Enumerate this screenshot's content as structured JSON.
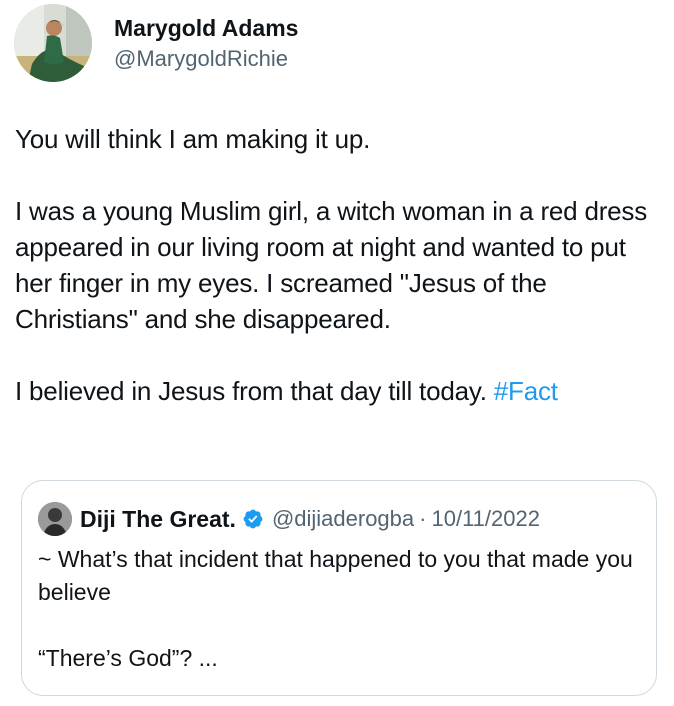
{
  "author": {
    "display_name": "Marygold Adams",
    "handle": "@MarygoldRichie",
    "avatar_icon": "profile-photo-avatar"
  },
  "tweet": {
    "paragraph_1": "You will think I am making it up.",
    "paragraph_2": "I was a young Muslim girl, a witch woman in a red dress appeared in our living room at night and wanted to put her finger in my eyes. I screamed \"Jesus of the Christians\" and she disappeared.",
    "paragraph_3_text": "I believed in Jesus from that day till today. ",
    "hashtag": "#Fact"
  },
  "quoted_tweet": {
    "display_name": "Diji The Great.",
    "verified_icon": "verified-badge-icon",
    "handle": "@dijiaderogba",
    "separator": "·",
    "date": "10/11/2022",
    "line_1": "~ What’s that incident that happened to you that made you believe",
    "line_2": "“There’s God”? ..."
  },
  "colors": {
    "text_primary": "#0f1419",
    "text_secondary": "#536471",
    "link": "#1d9bf0",
    "verified": "#1d9bf0",
    "border": "#cfd9de"
  }
}
